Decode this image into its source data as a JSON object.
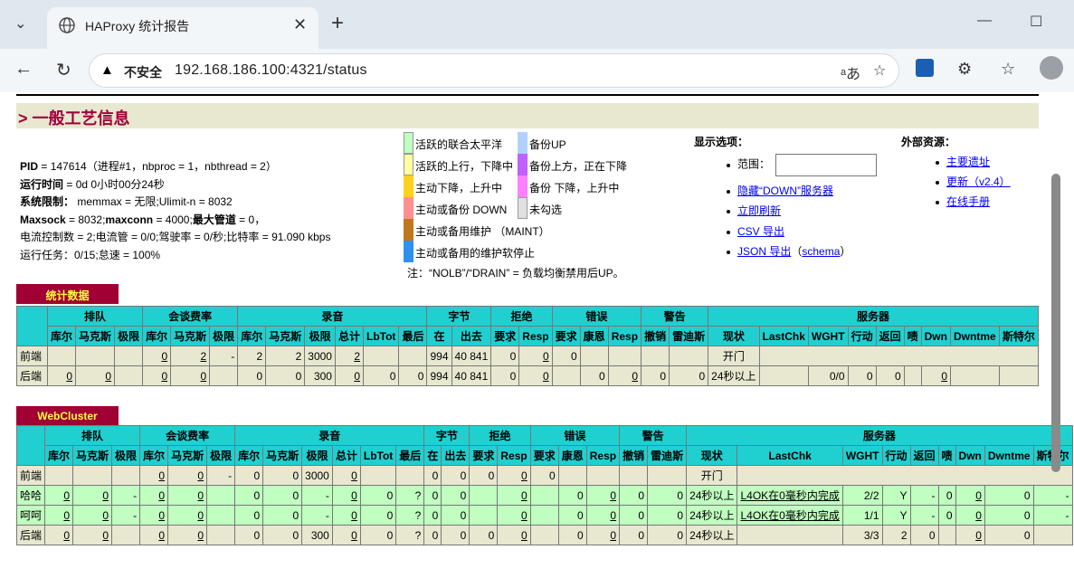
{
  "browser": {
    "tab_title": "HAProxy 统计报告",
    "insecure_label": "不安全",
    "url": "192.168.186.100:4321/status"
  },
  "section_title": "> 一般工艺信息",
  "info_lines": [
    "PID = 147614（进程#1，nbproc = 1，nbthread = 2）",
    "运行时间 = 0d 0小时00分24秒",
    "系统限制：  memmax = 无限;Ulimit-n = 8032",
    "Maxsock = 8032;maxconn = 4000;最大管道 = 0，",
    "电流控制数 = 2;电流管 = 0/0;驾驶率 = 0/秒;比特率 = 91.090 kbps",
    "运行任务：0/15;怠速 = 100%"
  ],
  "legend": [
    {
      "label": "活跃的联合太平洋",
      "color": "#c0ffc0"
    },
    {
      "label": "活跃的上行，下降中",
      "color": "#ffffa0"
    },
    {
      "label": "主动下降，上升中",
      "color": "#ffd020"
    },
    {
      "label": "主动或备份 DOWN",
      "color": "#ff9090"
    },
    {
      "label": "主动或备用维护 （MAINT）",
      "color": "#c07820"
    },
    {
      "label": "主动或备用的维护软停止",
      "color": "#3090f0"
    },
    {
      "label": "备份UP",
      "color": "#b0d0ff"
    },
    {
      "label": "备份上方，正在下降",
      "color": "#c060ff"
    },
    {
      "label": "备份 下降，上升中",
      "color": "#ff80ff"
    },
    {
      "label": "未勾选",
      "color": "#e0e0e0"
    }
  ],
  "legend_note": "注：“NOLB”/“DRAIN” = 负载均衡禁用后UP。",
  "display_options": {
    "title": "显示选项：",
    "scope_label": "范围：",
    "hide_down": "隐藏“DOWN”服务器",
    "refresh_now": "立即刷新",
    "csv_export": "CSV 导出",
    "json_export": "JSON 导出",
    "schema_open": "（",
    "schema": "schema",
    "schema_close": "）"
  },
  "external": {
    "title": "外部资源：",
    "home": "主要遗址",
    "update": "更新（v2.4）",
    "manual": "在线手册"
  },
  "stats_proxy": {
    "name": "统计数据",
    "groups": [
      "排队",
      "会谈费率",
      "录音",
      "字节",
      "拒绝",
      "错误",
      "警告",
      "服务器"
    ],
    "cols": [
      "库尔",
      "马克斯",
      "极限",
      "库尔",
      "马克斯",
      "极限",
      "库尔",
      "马克斯",
      "极限",
      "总计",
      "LbTot",
      "最后",
      "在",
      "出去",
      "要求",
      "Resp",
      "要求",
      "康恩",
      "Resp",
      "撤销",
      "雷迪斯",
      "现状",
      "LastChk",
      "WGHT",
      "行动",
      "返回",
      "啧",
      "Dwn",
      "Dwntme",
      "斯特尔"
    ],
    "frontend": {
      "label": "前端",
      "cells": [
        "",
        "",
        "",
        "0",
        "2",
        "-",
        "2",
        "2",
        "3000",
        "2",
        "",
        "",
        "994",
        "40 841",
        "0",
        "0",
        "0",
        "",
        "",
        "",
        "",
        "开门"
      ]
    },
    "backend": {
      "label": "后端",
      "cells": [
        "0",
        "0",
        "",
        "0",
        "0",
        "",
        "0",
        "0",
        "300",
        "0",
        "0",
        "0",
        "994",
        "40 841",
        "0",
        "0",
        "",
        "0",
        "0",
        "0",
        "0",
        "24秒以上",
        "",
        "0/0",
        "0",
        "0",
        "",
        "0",
        "",
        ""
      ]
    }
  },
  "webcluster": {
    "name": "WebCluster",
    "groups": [
      "排队",
      "会谈费率",
      "录音",
      "字节",
      "拒绝",
      "错误",
      "警告",
      "服务器"
    ],
    "cols": [
      "库尔",
      "马克斯",
      "极限",
      "库尔",
      "马克斯",
      "极限",
      "库尔",
      "马克斯",
      "极限",
      "总计",
      "LbTot",
      "最后",
      "在",
      "出去",
      "要求",
      "Resp",
      "要求",
      "康恩",
      "Resp",
      "撤销",
      "雷迪斯",
      "现状",
      "LastChk",
      "WGHT",
      "行动",
      "返回",
      "啧",
      "Dwn",
      "Dwntme",
      "斯特尔"
    ],
    "frontend": {
      "label": "前端",
      "cells": [
        "",
        "",
        "",
        "0",
        "0",
        "-",
        "0",
        "0",
        "3000",
        "0",
        "",
        "",
        "0",
        "0",
        "0",
        "0",
        "0",
        "",
        "",
        "",
        "",
        "开门"
      ]
    },
    "servers": [
      {
        "label": "哈哈",
        "cells": [
          "0",
          "0",
          "-",
          "0",
          "0",
          "",
          "0",
          "0",
          "-",
          "0",
          "0",
          "?",
          "0",
          "0",
          "",
          "0",
          "",
          "0",
          "0",
          "0",
          "0",
          "24秒以上",
          "L4OK在0毫秒内完成",
          "2/2",
          "Y",
          "-",
          "0",
          "0",
          "0",
          "-"
        ]
      },
      {
        "label": "呵呵",
        "cells": [
          "0",
          "0",
          "-",
          "0",
          "0",
          "",
          "0",
          "0",
          "-",
          "0",
          "0",
          "?",
          "0",
          "0",
          "",
          "0",
          "",
          "0",
          "0",
          "0",
          "0",
          "24秒以上",
          "L4OK在0毫秒内完成",
          "1/1",
          "Y",
          "-",
          "0",
          "0",
          "0",
          "-"
        ]
      }
    ],
    "backend": {
      "label": "后端",
      "cells": [
        "0",
        "0",
        "",
        "0",
        "0",
        "",
        "0",
        "0",
        "300",
        "0",
        "0",
        "?",
        "0",
        "0",
        "0",
        "0",
        "",
        "0",
        "0",
        "0",
        "0",
        "24秒以上",
        "",
        "3/3",
        "2",
        "0",
        "",
        "0",
        "0",
        ""
      ]
    }
  }
}
